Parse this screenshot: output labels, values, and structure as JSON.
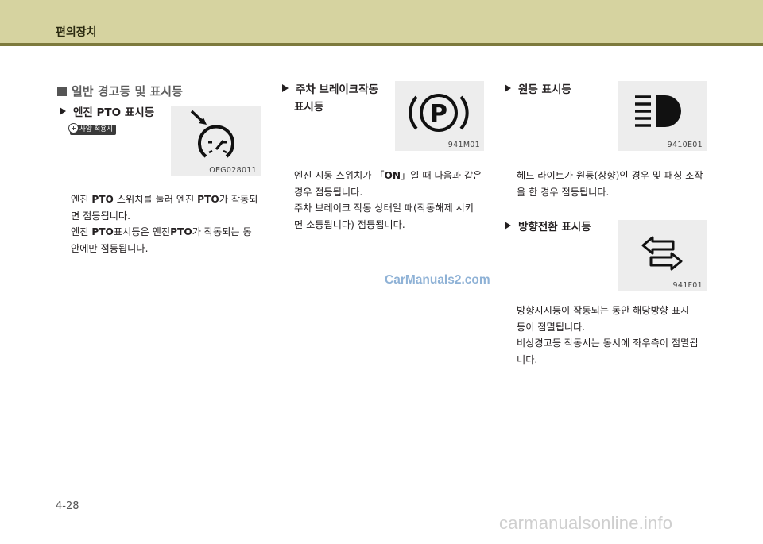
{
  "header": {
    "title": "편의장치"
  },
  "section": {
    "title": "일반 경고등 및 표시등"
  },
  "pto": {
    "title": "엔진 PTO 표시등",
    "badge": "사양 적용시",
    "image_code": "OEG028011",
    "lines": [
      [
        "엔진 ",
        "PTO",
        " 스위치를 눌러 엔진 ",
        "PTO",
        "가 작동되"
      ],
      [
        "면 점등됩니다."
      ],
      [
        "엔진 ",
        "PTO",
        "표시등은 엔진",
        "PTO",
        "가 작동되는 동"
      ],
      [
        "안에만 점등됩니다."
      ]
    ]
  },
  "parking": {
    "title_line1": "주차 브레이크작동",
    "title_line2": "표시등",
    "image_code": "941M01",
    "lines": [
      [
        "엔진 시동 스위치가 「",
        "ON",
        "」일 때 다음과 같은"
      ],
      [
        "경우 점등됩니다."
      ],
      [
        "주차 브레이크 작동 상태일 때(작동해제 시키"
      ],
      [
        "면 소등됩니다) 점등됩니다."
      ]
    ]
  },
  "highbeam": {
    "title": "원등 표시등",
    "image_code": "9410E01",
    "lines": [
      [
        "헤드 라이트가 원등(상향)인 경우 및 패싱 조작"
      ],
      [
        "을 한 경우 점등됩니다."
      ]
    ]
  },
  "turn": {
    "title": "방향전환 표시등",
    "image_code": "941F01",
    "lines": [
      [
        "방향지시등이 작동되는 동안 해당방향 표시"
      ],
      [
        "등이 점멸됩니다."
      ],
      [
        "비상경고등 작동시는 동시에 좌우측이 점멸됩"
      ],
      [
        "니다."
      ]
    ]
  },
  "watermark": "CarManuals2.com",
  "page_number": "4-28",
  "bottom_watermark": "carmanualsonline.info",
  "icons": [
    "pto-speedometer-icon",
    "parking-brake-icon",
    "high-beam-icon",
    "turn-signal-icon"
  ]
}
